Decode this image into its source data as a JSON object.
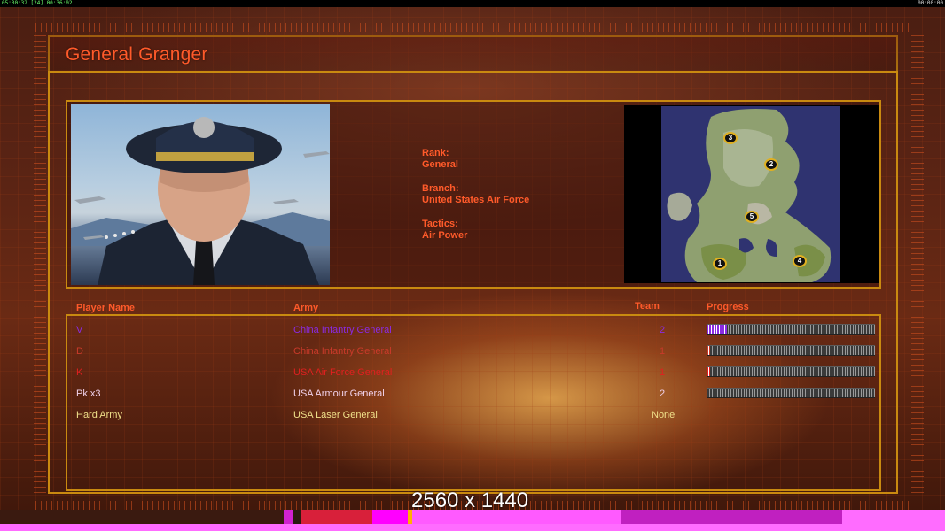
{
  "status_bar": {
    "left_text": "05:30:32 [24] 00:36:02",
    "right_text": "00:00:00"
  },
  "screen": {
    "title": "General Granger",
    "resolution_label": "2560 x 1440"
  },
  "general": {
    "rank_label": "Rank:",
    "rank_value": "General",
    "branch_label": "Branch:",
    "branch_value": "United States Air Force",
    "tactics_label": "Tactics:",
    "tactics_value": "Air Power"
  },
  "map": {
    "start_positions": [
      "1",
      "2",
      "3",
      "4",
      "5"
    ]
  },
  "roster": {
    "headers": {
      "player": "Player Name",
      "army": "Army",
      "team": "Team",
      "progress": "Progress"
    },
    "rows": [
      {
        "player": "V",
        "army": "China Infantry General",
        "team": "2",
        "progress": 0.12,
        "color": "#8a2be2"
      },
      {
        "player": "D",
        "army": "China Infantry General",
        "team": "1",
        "progress": 0.02,
        "color": "#c83a2a"
      },
      {
        "player": "K",
        "army": "USA Air Force General",
        "team": "1",
        "progress": 0.02,
        "color": "#e02020"
      },
      {
        "player": "Pk x3",
        "army": "USA Armour General",
        "team": "2",
        "progress": 0.0,
        "color": "#f0d0e8"
      },
      {
        "player": "Hard Army",
        "army": "USA Laser General",
        "team": "None",
        "progress": null,
        "color": "#f0e08a"
      }
    ]
  },
  "colors": {
    "accent": "#ff5a2a",
    "frame": "#c98a10"
  }
}
